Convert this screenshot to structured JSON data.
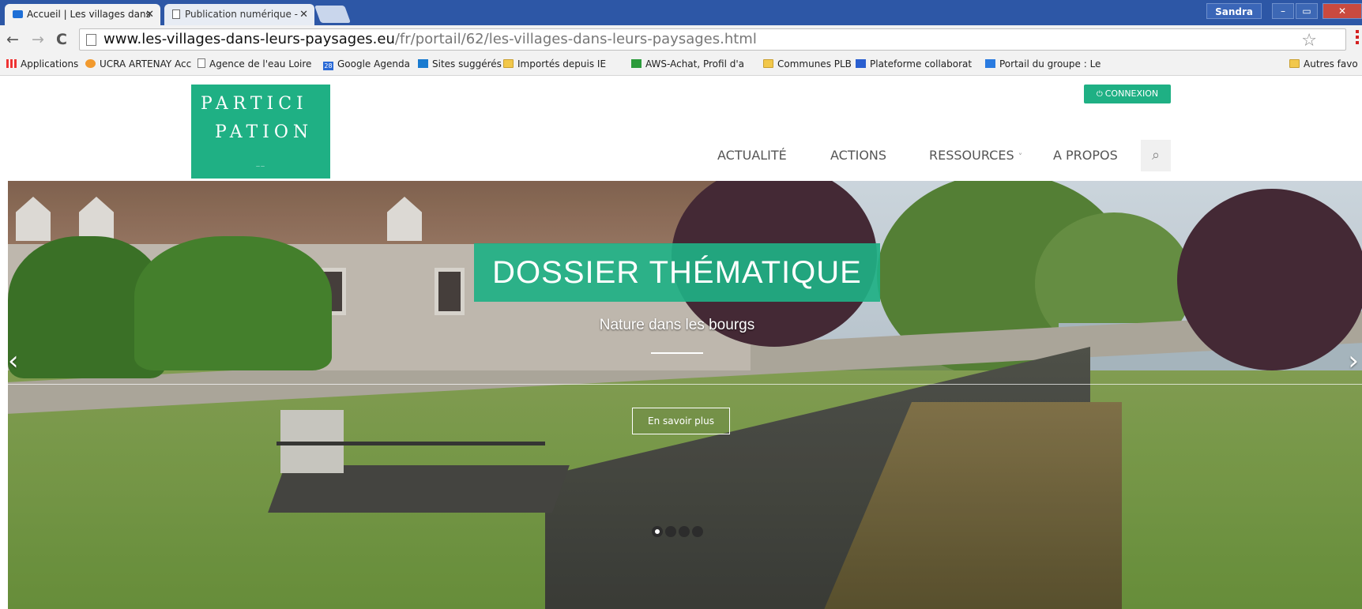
{
  "browser": {
    "tabs": [
      {
        "title": "Accueil | Les villages dans",
        "active": true
      },
      {
        "title": "Publication numérique - ",
        "active": false
      }
    ],
    "user": "Sandra",
    "window_controls": {
      "minimize": "–",
      "restore": "▭",
      "close": "✕"
    },
    "url_host": "www.les-villages-dans-leurs-paysages.eu",
    "url_path": "/fr/portail/62/les-villages-dans-leurs-paysages.html",
    "bookmarks": [
      {
        "label": "Applications",
        "icon": "apps-icon"
      },
      {
        "label": "UCRA ARTENAY  Acc",
        "icon": "ucra-icon"
      },
      {
        "label": "Agence de l'eau Loire",
        "icon": "page-icon"
      },
      {
        "label": "Google Agenda",
        "icon": "calendar-icon"
      },
      {
        "label": "Sites suggérés",
        "icon": "bing-icon"
      },
      {
        "label": "Importés depuis IE",
        "icon": "folder-icon"
      },
      {
        "label": "AWS-Achat, Profil d'a",
        "icon": "green-square-icon"
      },
      {
        "label": "Communes PLB",
        "icon": "folder-icon"
      },
      {
        "label": "Plateforme collaborat",
        "icon": "alpha-icon"
      },
      {
        "label": "Portail du groupe : Le",
        "icon": "camera-icon"
      }
    ],
    "other_bookmarks": "Autres favo"
  },
  "site": {
    "logo": {
      "line1": "PARTICI",
      "line2": "PATION",
      "tagline": "——"
    },
    "login_label": "CONNEXION",
    "nav": [
      "ACTUALITÉ",
      "ACTIONS",
      "RESSOURCES",
      "A PROPOS"
    ],
    "dropdown_caret": "˅",
    "search_icon": "⌕"
  },
  "hero": {
    "title": "DOSSIER THÉMATIQUE",
    "subtitle": "Nature dans les bourgs",
    "cta": "En savoir plus",
    "prev": "‹",
    "next": "›",
    "slides": 4,
    "active_slide": 1
  },
  "colors": {
    "brand_green": "#1fb084",
    "tab_strip": "#2d57a6"
  }
}
